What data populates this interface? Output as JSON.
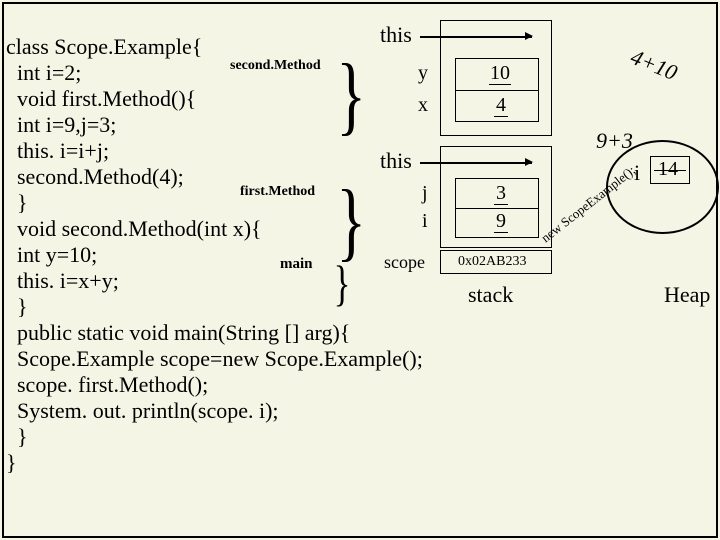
{
  "code": {
    "l1": "class Scope.Example{",
    "l2": "  int i=2;",
    "l3": "  void first.Method(){",
    "l4": "  int i=9,j=3;",
    "l5": "  this. i=i+j;",
    "l6": "  second.Method(4);",
    "l7": "  }",
    "l8": "  void second.Method(int x){",
    "l9": "  int y=10;",
    "l10": "  this. i=x+y;",
    "l11": "  }",
    "l12": "  public static void main(String [] arg){",
    "l13": "  Scope.Example scope=new Scope.Example();",
    "l14": "  scope. first.Method();",
    "l15": "  System. out. println(scope. i);",
    "l16": "  }",
    "l17": "}"
  },
  "labels": {
    "secondMethod": "second.Method",
    "firstMethod": "first.Method",
    "main": "main",
    "stack": "stack",
    "heap": "Heap",
    "scope": "scope"
  },
  "stack": {
    "frame_second": {
      "this": "this",
      "var1": "y",
      "val1": "10",
      "var2": "x",
      "val2": "4"
    },
    "frame_first": {
      "this": "this",
      "var1": "j",
      "val1": "3",
      "var2": "i",
      "val2": "9"
    },
    "frame_main": {
      "hex": "0x02AB233"
    }
  },
  "heap": {
    "i": "i",
    "i_val": "14",
    "new": "new ScopeExample();"
  },
  "expr": {
    "e1": "4+10",
    "e2": "9+3"
  }
}
